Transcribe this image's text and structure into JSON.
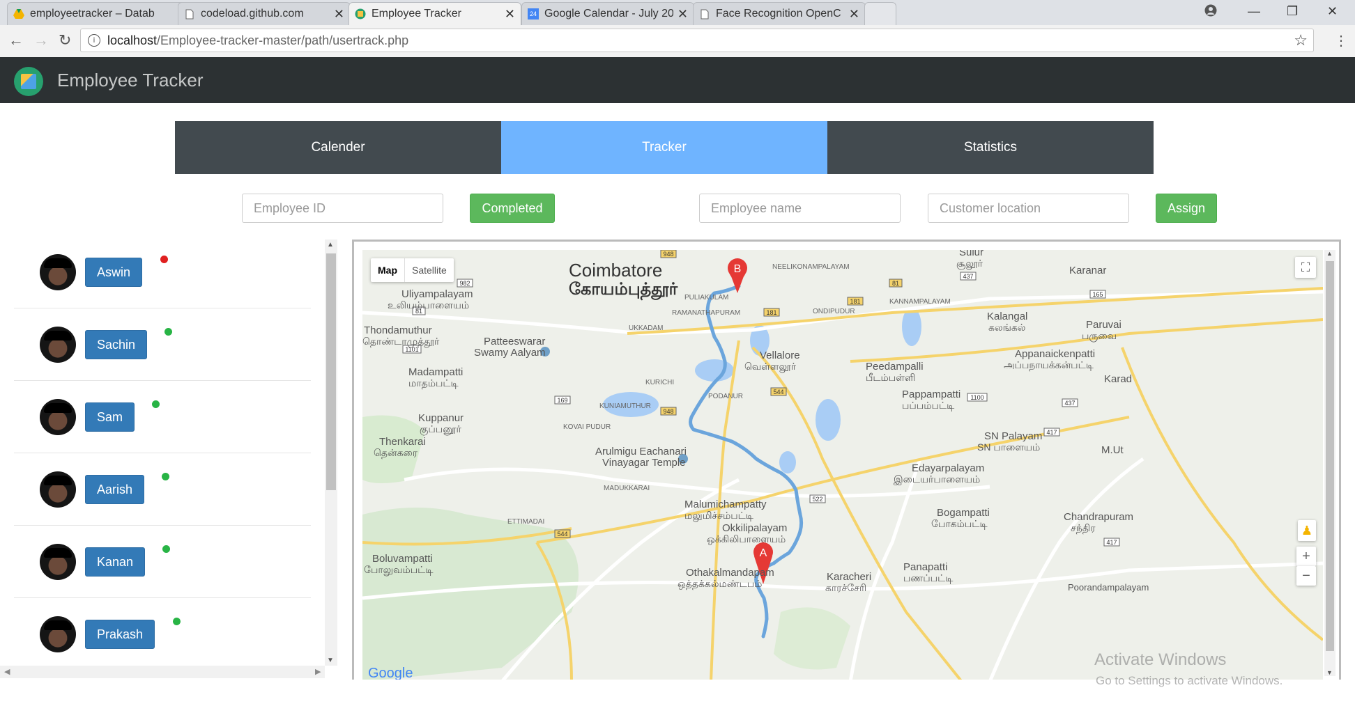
{
  "browser": {
    "tabs": [
      {
        "label": "employeetracker – Datab",
        "icon": "drive-icon",
        "active": false
      },
      {
        "label": "codeload.github.com",
        "icon": "page-icon",
        "active": false
      },
      {
        "label": "Employee Tracker",
        "icon": "site-icon",
        "active": true
      },
      {
        "label": "Google Calendar - July 20",
        "icon": "calendar-icon",
        "active": false
      },
      {
        "label": "Face Recognition OpenC",
        "icon": "page-icon",
        "active": false
      }
    ],
    "calendar_icon_text": "24",
    "url_host": "localhost",
    "url_path": "/Employee-tracker-master/path/usertrack.php"
  },
  "app": {
    "title": "Employee Tracker"
  },
  "nav": [
    {
      "label": "Calender",
      "active": false
    },
    {
      "label": "Tracker",
      "active": true
    },
    {
      "label": "Statistics",
      "active": false
    }
  ],
  "form": {
    "employee_id_placeholder": "Employee ID",
    "completed_label": "Completed",
    "employee_name_placeholder": "Employee name",
    "customer_location_placeholder": "Customer location",
    "assign_label": "Assign"
  },
  "employees": [
    {
      "name": "Aswin",
      "status": "offline",
      "status_color": "#e02020"
    },
    {
      "name": "Sachin",
      "status": "online",
      "status_color": "#28b445"
    },
    {
      "name": "Sam",
      "status": "online",
      "status_color": "#28b445"
    },
    {
      "name": "Aarish",
      "status": "online",
      "status_color": "#28b445"
    },
    {
      "name": "Kanan",
      "status": "online",
      "status_color": "#28b445"
    },
    {
      "name": "Prakash",
      "status": "online",
      "status_color": "#28b445"
    }
  ],
  "map": {
    "map_type_map": "Map",
    "map_type_satellite": "Satellite",
    "marker_a": "A",
    "marker_b": "B",
    "google": "Google",
    "places": {
      "coimbatore_en": "Coimbatore",
      "coimbatore_ta": "கோயம்புத்தூர்",
      "uliyampalayam": "Uliyampalayam",
      "uliyampalayam_ta": "உலியம்பாளையம்",
      "thondamuthur": "Thondamuthur",
      "thondamuthur_ta": "தொண்டாமுத்தூர்",
      "patteeswarar": "Patteeswarar",
      "patteeswarar2": "Swamy Aalyam",
      "madampatti": "Madampatti",
      "madampatti_ta": "மாதம்பட்டி",
      "kuppanur": "Kuppanur",
      "kuppanur_ta": "குப்பனூர்",
      "thenkarai": "Thenkarai",
      "thenkarai_ta": "தென்கரை",
      "arulmigu": "Arulmigu Eachanari",
      "arulmigu2": "Vinayagar Temple",
      "malumichampatty": "Malumichampatty",
      "malumichampatty_ta": "மலுமிச்சம்பட்டி",
      "okkilipalayam": "Okkilipalayam",
      "okkilipalayam_ta": "ஒக்கிலிபாளையம்",
      "othakalmandapam": "Othakalmandapam",
      "othakalmandapam_ta": "ஒத்தக்கல்மண்டபம்",
      "boluvampatti": "Boluvampatti",
      "boluvampatti_ta": "போலுவம்பட்டி",
      "vellalore": "Vellalore",
      "vellalore_ta": "வெள்ளலூர்",
      "peedampalli": "Peedampalli",
      "peedampalli_ta": "பீடம்பள்ளி",
      "pappampatti": "Pappampatti",
      "pappampatti_ta": "பப்பம்பட்டி",
      "sn_palayam": "SN Palayam",
      "sn_palayam_ta": "SN பாளையம்",
      "edayarpalayam": "Edayarpalayam",
      "edayarpalayam_ta": "இடையர்பாளையம்",
      "bogampatti": "Bogampatti",
      "bogampatti_ta": "போகம்பட்டி",
      "panapatti": "Panapatti",
      "panapatti_ta": "பணப்பட்டி",
      "karacheri": "Karacheri",
      "karacheri_ta": "காரச்சேரி",
      "kalangal": "Kalangal",
      "kalangal_ta": "கலங்கல்",
      "paruvai": "Paruvai",
      "paruvai_ta": "பருவை",
      "appanaickenpatti": "Appanaickenpatti",
      "appanaickenpatti_ta": "அப்பநாயக்கன்பட்டி",
      "sulur": "Sulur",
      "sulur_ta": "சூலூர்",
      "chandrapuram": "Chandrapuram",
      "chandrapuram_ta": "சந்திர",
      "poorandampalayam": "Poorandampalayam",
      "neelikonampalayam": "NEELIKONAMPALAYAM",
      "kannampalayam": "KANNAMPALAYAM",
      "puliakulam": "PULIAKULAM",
      "ramanathapuram": "RAMANATHAPURAM",
      "ukkadam": "UKKADAM",
      "ondipudur": "ONDIPUDUR",
      "kurichi": "KURICHI",
      "podanur": "PODANUR",
      "kuniamuthur": "KUNIAMUTHUR",
      "kovai_pudur": "KOVAI PUDUR",
      "madukkarai": "MADUKKARAI",
      "ettimadai": "ETTIMADAI",
      "karanar": "Karanar",
      "karadi": "Karad",
      "m_ut": "M.Ut"
    },
    "route_shields": [
      "982",
      "81",
      "1101",
      "169",
      "948",
      "181",
      "544",
      "1100",
      "437",
      "417",
      "522",
      "165",
      "81",
      "437",
      "181",
      "948",
      "544",
      "417"
    ]
  },
  "watermark": {
    "line1": "Activate Windows",
    "line2": "Go to Settings to activate Windows."
  }
}
